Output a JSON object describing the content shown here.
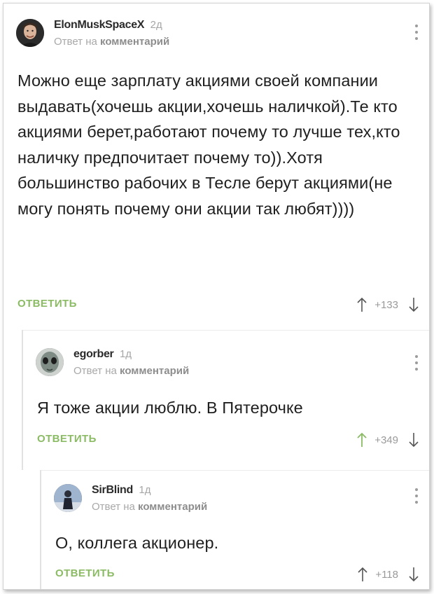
{
  "comments": [
    {
      "nick": "ElonMuskSpaceX",
      "age": "2д",
      "reply_prefix": "Ответ на",
      "reply_target": "комментарий",
      "text": "Можно еще зарплату акциями своей компании выдавать(хочешь акции,хочешь наличкой).Те кто акциями берет,работают почему то лучше тех,кто наличку предпочитает почему то)).Хотя большинство рабочих в Тесле берут акциями(не могу понять почему они акции так любят))))",
      "reply_label": "ОТВЕТИТЬ",
      "score": "+133",
      "avatar_icon": "elon-avatar",
      "up_arrow_color": "#555555"
    },
    {
      "nick": "egorber",
      "age": "1д",
      "reply_prefix": "Ответ на",
      "reply_target": "комментарий",
      "text": "Я тоже акции люблю. В Пятерочке",
      "reply_label": "ОТВЕТИТЬ",
      "score": "+349",
      "avatar_icon": "alien-avatar",
      "up_arrow_color": "#8bbb64"
    },
    {
      "nick": "SirBlind",
      "age": "1д",
      "reply_prefix": "Ответ на",
      "reply_target": "комментарий",
      "text": "О, коллега акционер.",
      "reply_label": "ОТВЕТИТЬ",
      "score": "+118",
      "avatar_icon": "person-avatar",
      "up_arrow_color": "#555555"
    }
  ],
  "colors": {
    "accent_green": "#8bbb64",
    "muted_text": "#a8a8a8",
    "body_text": "#1f1f1f"
  }
}
